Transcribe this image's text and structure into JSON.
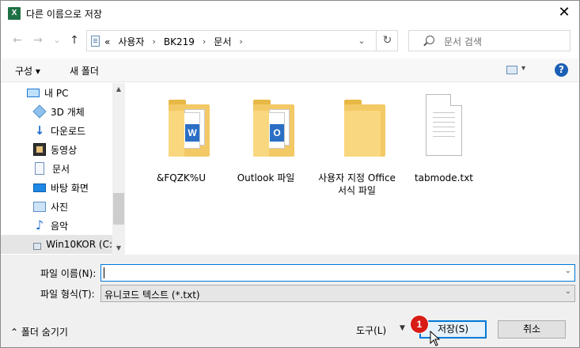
{
  "window": {
    "title": "다른 이름으로 저장",
    "app_icon": "X",
    "close_icon": "✕"
  },
  "nav_buttons": {
    "back": "←",
    "forward": "→",
    "recent": "⌄",
    "up": "↑"
  },
  "address": {
    "crumbs": [
      "«",
      "사용자",
      "BK219",
      "문서"
    ],
    "separator": "›"
  },
  "search": {
    "placeholder": "문서 검색"
  },
  "toolbar": {
    "organize": "구성 ▾",
    "new_folder": "새 폴더",
    "help": "?"
  },
  "nav_pane": {
    "items": [
      {
        "label": "내 PC",
        "icon": "pc-icon"
      },
      {
        "label": "3D 개체",
        "icon": "3d-objects-icon"
      },
      {
        "label": "다운로드",
        "icon": "downloads-icon"
      },
      {
        "label": "동영상",
        "icon": "videos-icon"
      },
      {
        "label": "문서",
        "icon": "documents-icon"
      },
      {
        "label": "바탕 화면",
        "icon": "desktop-icon"
      },
      {
        "label": "사진",
        "icon": "pictures-icon"
      },
      {
        "label": "음악",
        "icon": "music-icon"
      },
      {
        "label": "Win10KOR (C:",
        "icon": "drive-icon"
      }
    ]
  },
  "files": [
    {
      "name": "&FQZK%U",
      "type": "folder-with-docs"
    },
    {
      "name": "Outlook 파일",
      "type": "folder-with-docs"
    },
    {
      "name": "사용자 지정 Office 서식 파일",
      "type": "folder"
    },
    {
      "name": "tabmode.txt",
      "type": "text-file"
    }
  ],
  "form": {
    "filename_label": "파일 이름(N):",
    "filename_value": "",
    "filetype_label": "파일 형식(T):",
    "filetype_value": "유니코드 텍스트 (*.txt)"
  },
  "footer": {
    "hide_folders": "폴더 숨기기",
    "tools": "도구(L)",
    "save": "저장(S)",
    "cancel": "취소"
  },
  "annotation": {
    "step_badge": "1"
  }
}
